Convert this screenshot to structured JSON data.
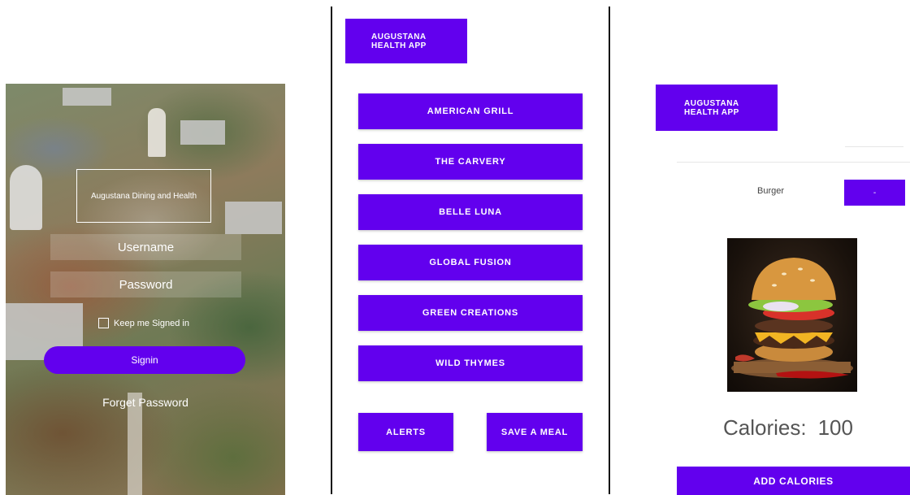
{
  "login_screen": {
    "title": "Augustana Dining and Health",
    "username_placeholder": "Username",
    "password_placeholder": "Password",
    "keep_signed_in_label": "Keep me Signed in",
    "signin_label": "Signin",
    "forget_password_label": "Forget Password"
  },
  "restaurants_screen": {
    "app_badge_line1": "AUGUSTANA",
    "app_badge_line2": "HEALTH APP",
    "restaurants": [
      {
        "label": "AMERICAN GRILL"
      },
      {
        "label": "THE CARVERY"
      },
      {
        "label": "BELLE LUNA"
      },
      {
        "label": "GLOBAL FUSION"
      },
      {
        "label": "GREEN CREATIONS"
      },
      {
        "label": "WILD THYMES"
      }
    ],
    "alerts_label": "ALERTS",
    "save_meal_label": "SAVE A MEAL"
  },
  "food_screen": {
    "app_badge_line1": "AUGUSTANA",
    "app_badge_line2": "HEALTH APP",
    "food_name": "Burger",
    "mini_button_label": "-",
    "calories_label": "Calories:",
    "calories_value": "100",
    "add_calories_label": "ADD CALORIES",
    "photo_icon": "burger-photo"
  },
  "colors": {
    "accent": "#6200ee"
  }
}
